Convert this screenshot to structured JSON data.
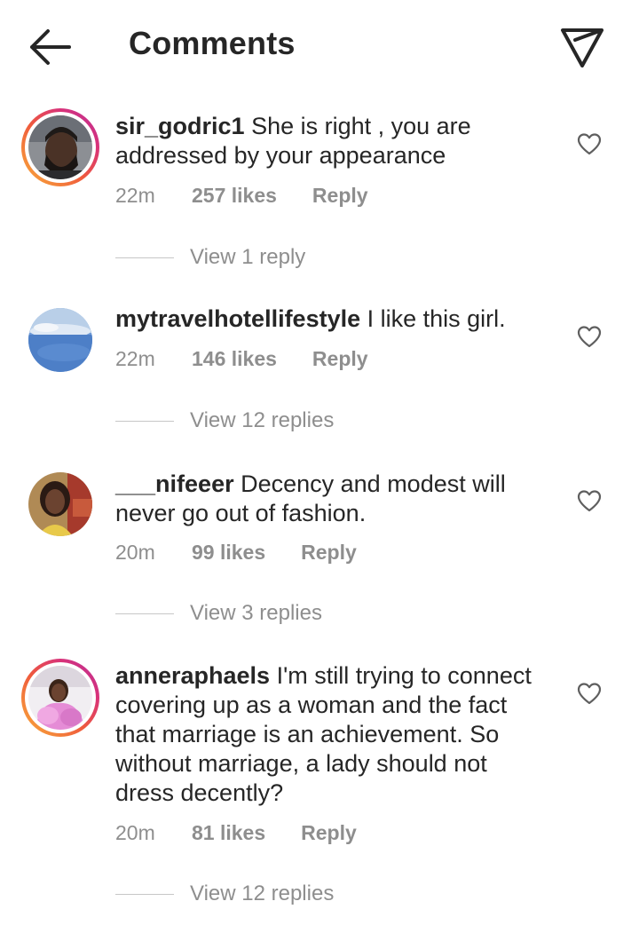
{
  "header": {
    "title": "Comments"
  },
  "comments": [
    {
      "username": "sir_godric1",
      "text": " She is right , you are addressed by your appearance",
      "time": "22m",
      "likes": "257 likes",
      "reply": "Reply",
      "view_replies": "View 1 reply",
      "has_story": true
    },
    {
      "username": "mytravelhotellifestyle",
      "text": " I like this girl.",
      "time": "22m",
      "likes": "146 likes",
      "reply": "Reply",
      "view_replies": "View 12 replies",
      "has_story": false
    },
    {
      "username": "___nifeeer",
      "text": " Decency and modest will never go out of fashion.",
      "time": "20m",
      "likes": "99 likes",
      "reply": "Reply",
      "view_replies": "View 3 replies",
      "has_story": false
    },
    {
      "username": "anneraphaels",
      "text": " I'm still trying to connect covering up as a woman and the fact that marriage is an achievement. So without marriage, a lady should not dress decently?",
      "time": "20m",
      "likes": "81 likes",
      "reply": "Reply",
      "view_replies": "View 12 replies",
      "has_story": true
    }
  ],
  "icons": {
    "back": "arrow-left-icon",
    "send": "paper-plane-icon",
    "like": "heart-outline-icon"
  },
  "colors": {
    "text": "#262626",
    "secondary": "#8e8e8e",
    "story_ring_start": "#f9b03a",
    "story_ring_end": "#b72f9a"
  }
}
